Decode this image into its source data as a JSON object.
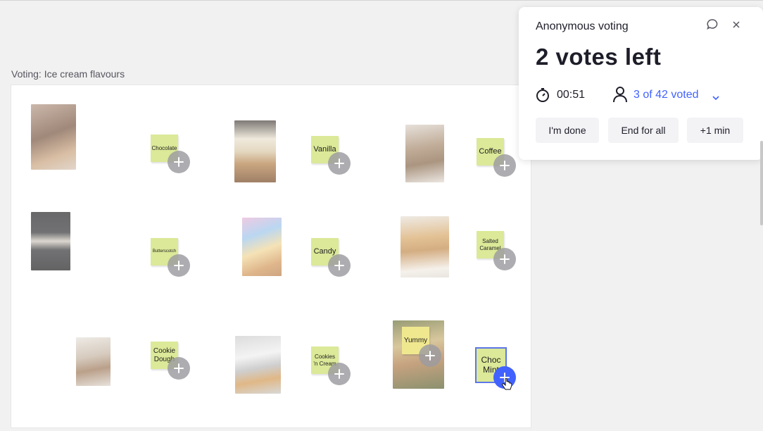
{
  "frame": {
    "title": "Voting: Ice cream flavours"
  },
  "stickies": [
    {
      "id": "chocolate",
      "label": "Chocolate"
    },
    {
      "id": "vanilla",
      "label": "Vanilla"
    },
    {
      "id": "coffee",
      "label": "Coffee"
    },
    {
      "id": "butterscotch",
      "label": "Butterscotch"
    },
    {
      "id": "candy",
      "label": "Candy"
    },
    {
      "id": "salted-caramel",
      "label": "Salted Caramel"
    },
    {
      "id": "cookie-dough",
      "label": "Cookie Dough"
    },
    {
      "id": "cookies-n-cream",
      "label": "Cookies 'n Cream"
    },
    {
      "id": "yummy",
      "label": "Yummy"
    },
    {
      "id": "choc-mint",
      "label": "Choc Mint"
    }
  ],
  "panel": {
    "title": "Anonymous voting",
    "votes_left": "2 votes left",
    "timer": "00:51",
    "voted": "3 of 42 voted",
    "buttons": {
      "done": "I'm done",
      "end": "End for all",
      "plus_min": "+1 min"
    }
  },
  "icons": {
    "comment": "comment-icon",
    "close": "close-icon",
    "timer": "timer-icon",
    "user": "user-icon",
    "chevron": "chevron-down-icon",
    "plus": "plus-icon",
    "cursor": "hand-cursor-icon"
  },
  "colors": {
    "accent": "#4262ff",
    "sticky": "#dbe998",
    "selection": "#5d76e8"
  }
}
